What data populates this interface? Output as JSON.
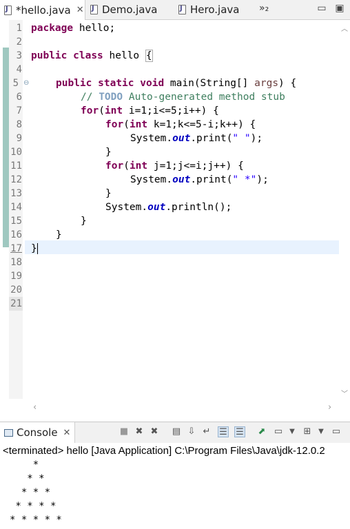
{
  "tabs": [
    {
      "label": "*hello.java",
      "active": true
    },
    {
      "label": "Demo.java",
      "active": false
    },
    {
      "label": "Hero.java",
      "active": false
    }
  ],
  "tab_overflow": "»₂",
  "editor": {
    "line_numbers": [
      "1",
      "2",
      "3",
      "4",
      "5",
      "6",
      "7",
      "8",
      "9",
      "10",
      "11",
      "12",
      "13",
      "14",
      "15",
      "16",
      "17",
      "18",
      "19",
      "20",
      "21"
    ],
    "code": {
      "l1_kw": "package",
      "l1_rest": " hello;",
      "l3_kw1": "public",
      "l3_kw2": "class",
      "l3_rest": " hello ",
      "l5_kw1": "public",
      "l5_kw2": "static",
      "l5_kw3": "void",
      "l5_rest": " main(String[] ",
      "l5_arg": "args",
      "l5_end": ") {",
      "l6_comment_a": "// ",
      "l6_todo": "TODO",
      "l6_comment_b": " Auto-generated method stub",
      "l7_kw1": "for",
      "l7_mid": "(",
      "l7_kw2": "int",
      "l7_rest": " i=1;i<=5;i++) {",
      "l8_kw1": "for",
      "l8_mid": "(",
      "l8_kw2": "int",
      "l8_rest": " k=1;k<=5-i;k++) {",
      "l9_a": "System.",
      "l9_fld": "out",
      "l9_b": ".print(",
      "l9_str": "\" \"",
      "l9_c": ");",
      "l10": "}",
      "l11_kw1": "for",
      "l11_mid": "(",
      "l11_kw2": "int",
      "l11_rest": " j=1;j<=i;j++) {",
      "l12_a": "System.",
      "l12_fld": "out",
      "l12_b": ".print(",
      "l12_str": "\" *\"",
      "l12_c": ");",
      "l13": "}",
      "l14_a": "System.",
      "l14_fld": "out",
      "l14_b": ".println();",
      "l15": "}",
      "l16": "}",
      "l17": "}"
    }
  },
  "console": {
    "title": "Console",
    "status": "<terminated> hello [Java Application] C:\\Program Files\\Java\\jdk-12.0.2",
    "output": [
      "    *",
      "   * *",
      "  * * *",
      " * * * *",
      "* * * * *"
    ]
  },
  "colors": {
    "keyword": "#7f0055",
    "comment": "#3f7f5f",
    "string": "#2a00ff",
    "field": "#0000c0"
  }
}
